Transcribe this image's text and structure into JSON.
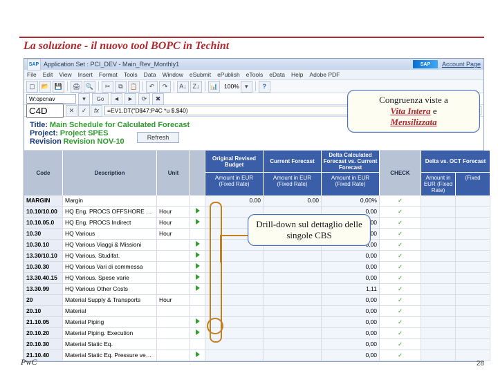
{
  "slide": {
    "title": "La soluzione - il nuovo tool BOPC in Techint",
    "footer": "PwC",
    "page": "28"
  },
  "sap": {
    "titlebar_icon": "SAP",
    "titlebar": "Application Set : PCI_DEV - Main_Rev_Monthly1",
    "account_page": "Account Page",
    "sap_badge": "SAP",
    "menu": [
      "File",
      "Edit",
      "View",
      "Insert",
      "Format",
      "Tools",
      "Data",
      "Window",
      "eSubmit",
      "ePublish",
      "eTools",
      "eData",
      "Help",
      "Adobe PDF"
    ],
    "goto_label": "W:opcnav",
    "goto_btn": "Go",
    "cellref": "C4D",
    "formula": "=EV1.DT(\"D$47:P4C *u $.$40)"
  },
  "report": {
    "title_label": "Title:",
    "title_val": "Main Schedule for Calculated Forecast",
    "project_label": "Project:",
    "project_val": "Project SPES",
    "revision_label": "Revision",
    "revision_val": "Revision NOV-10",
    "refresh": "Refresh"
  },
  "cols": {
    "code": "Code",
    "desc": "Description",
    "unit": "Unit",
    "orb": "Original Revised Budget",
    "cf": "Current Forecast",
    "delta": "Delta Calculated Forecast vs. Current Forecast",
    "check": "CHECK",
    "deltaoct": "Delta vs. OCT Forecast",
    "amt": "Amount in EUR (Fixed Rate)",
    "fixed": "(Fixed"
  },
  "rows": [
    {
      "code": "MARGIN",
      "desc": "Margin",
      "unit": "",
      "dd": "",
      "v1": "0.00",
      "v2": "0.00",
      "v3": "0,00%",
      "chk": "✓",
      "v4": ""
    },
    {
      "code": "10.10/10.00",
      "desc": "HQ Eng. PROCS OFFSHORE ext.srv",
      "unit": "Hour",
      "dd": "▶",
      "v1": "",
      "v2": "",
      "v3": "0,00",
      "chk": "✓",
      "v4": ""
    },
    {
      "code": "10.10.05.0",
      "desc": "HQ Eng. PROCS Indirect",
      "unit": "Hour",
      "dd": "▶",
      "v1": "",
      "v2": "",
      "v3": "0,00",
      "chk": "✓",
      "v4": ""
    },
    {
      "code": "10.30",
      "desc": "HQ Various",
      "unit": "Hour",
      "dd": "",
      "v1": "",
      "v2": "",
      "v3": "0,00",
      "chk": "✓",
      "v4": ""
    },
    {
      "code": "10.30.10",
      "desc": "HQ Various Viaggi & Missioni",
      "unit": "",
      "dd": "▶",
      "v1": "",
      "v2": "",
      "v3": "0,00",
      "chk": "✓",
      "v4": ""
    },
    {
      "code": "13.30/10.10",
      "desc": "HQ Various. Studifat.",
      "unit": "",
      "dd": "▶",
      "v1": "",
      "v2": "",
      "v3": "0,00",
      "chk": "✓",
      "v4": ""
    },
    {
      "code": "10.30.30",
      "desc": "HQ Various Vari di commessa",
      "unit": "",
      "dd": "▶",
      "v1": "",
      "v2": "",
      "v3": "0,00",
      "chk": "✓",
      "v4": ""
    },
    {
      "code": "13.30.40.15",
      "desc": "HQ Various. Spese varie",
      "unit": "",
      "dd": "▶",
      "v1": "",
      "v2": "",
      "v3": "0,00",
      "chk": "✓",
      "v4": ""
    },
    {
      "code": "13.30.99",
      "desc": "HQ Various Other Costs",
      "unit": "",
      "dd": "▶",
      "v1": "",
      "v2": "",
      "v3": "1,11",
      "chk": "✓",
      "v4": ""
    },
    {
      "code": "20",
      "desc": "Material Supply & Transports",
      "unit": "Hour",
      "dd": "",
      "v1": "",
      "v2": "",
      "v3": "0,00",
      "chk": "✓",
      "v4": ""
    },
    {
      "code": "20.10",
      "desc": "Material",
      "unit": "",
      "dd": "",
      "v1": "",
      "v2": "",
      "v3": "0,00",
      "chk": "✓",
      "v4": ""
    },
    {
      "code": "21.10.05",
      "desc": "Material Piping",
      "unit": "",
      "dd": "▶",
      "v1": "",
      "v2": "",
      "v3": "0,00",
      "chk": "✓",
      "v4": ""
    },
    {
      "code": "20.10.20",
      "desc": "Material Piping. Execution",
      "unit": "",
      "dd": "▶",
      "v1": "",
      "v2": "",
      "v3": "0,00",
      "chk": "✓",
      "v4": ""
    },
    {
      "code": "20.10.30",
      "desc": "Material Static Eq.",
      "unit": "",
      "dd": "",
      "v1": "",
      "v2": "",
      "v3": "0,00",
      "chk": "✓",
      "v4": ""
    },
    {
      "code": "21.10.40",
      "desc": "Material Static Eq. Pressure vessels",
      "unit": "",
      "dd": "▶",
      "v1": "",
      "v2": "",
      "v3": "0,00",
      "chk": "✓",
      "v4": ""
    }
  ],
  "callouts": {
    "top": {
      "l1": "Congruenza viste a",
      "l2": "Vita Intera",
      "l3": " e",
      "l4": "Mensilizzata"
    },
    "mid": {
      "t": "Drill-down sul dettaglio delle singole CBS"
    }
  }
}
